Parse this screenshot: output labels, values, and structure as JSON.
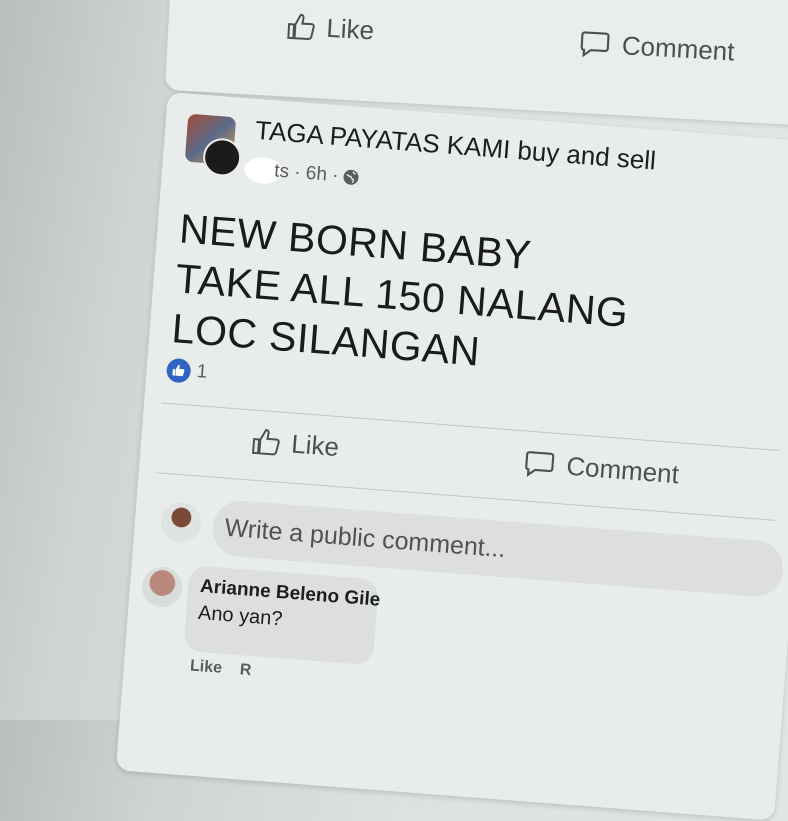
{
  "previous_post": {
    "like_label": "Like",
    "comment_label": "Comment"
  },
  "post": {
    "group_name": "TAGA PAYATAS KAMI buy and sell",
    "meta": "ts · 6h ·",
    "text": "NEW BORN BABY\nTAKE ALL 150 NALANG\nLOC SILANGAN",
    "reaction_count": "1",
    "like_label": "Like",
    "comment_label": "Comment",
    "comment_placeholder": "Write a public comment..."
  },
  "comment": {
    "author": "Arianne Beleno Gile",
    "text": "Ano yan?",
    "like_label": "Like",
    "reply_label": "R"
  },
  "colors": {
    "like_badge": "#2f63c4",
    "card_bg": "#e8ecea"
  }
}
